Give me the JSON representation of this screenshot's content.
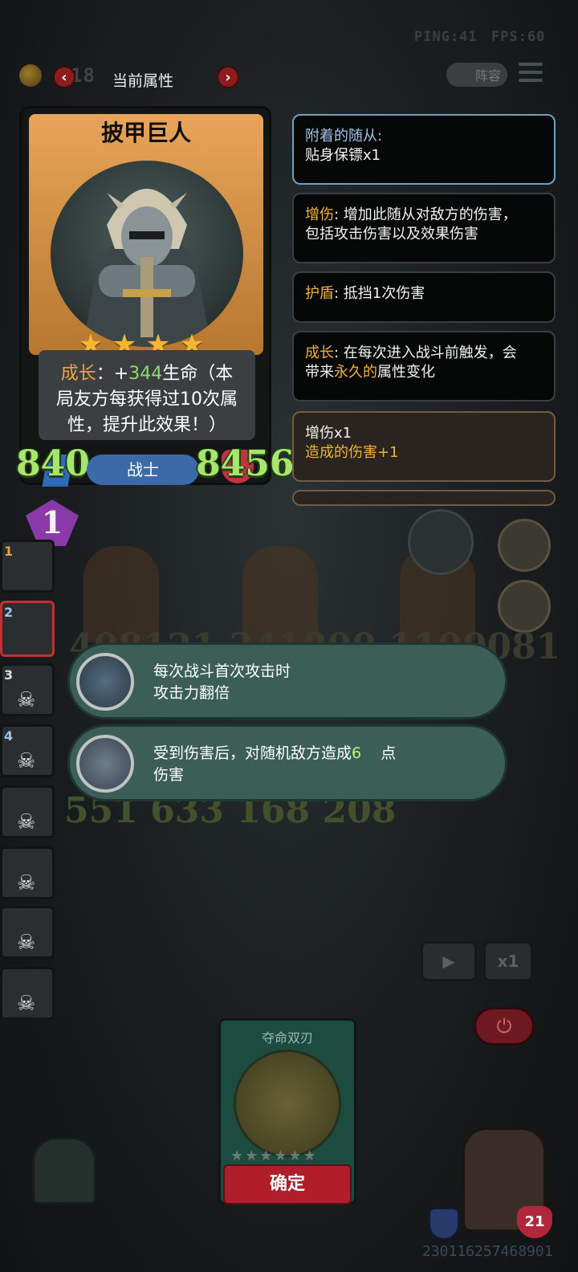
{
  "hud": {
    "ping": "PING:41",
    "fps": "FPS:60",
    "coin_value": "18",
    "panel_title": "当前属性",
    "lineup_label": "阵容"
  },
  "hero": {
    "name": "披甲巨人",
    "stars": 4,
    "desc_line1_label": "成长",
    "desc_line1_sep": "：+",
    "desc_line1_value": "344",
    "desc_line1_rest": "生命（本",
    "desc_line2": "局友方每获得过10次属",
    "desc_line3": "性，提升此效果！）",
    "attack": "840",
    "health": "8456",
    "class": "战士",
    "level_badge": "1"
  },
  "info": {
    "attached_title": "附着的随从:",
    "attached_value": "贴身保镖x1",
    "dmg_kw": "增伤",
    "dmg_line1": ": 增加此随从对敌方的伤害，",
    "dmg_line2": "包括攻击伤害以及效果伤害",
    "shield_kw": "护盾",
    "shield_text": ": 抵挡1次伤害",
    "grow_kw": "成长",
    "grow_line1": ": 在每次进入战斗前触发，会",
    "grow_line2_a": "带来",
    "grow_line2_kw": "永久的",
    "grow_line2_b": "属性变化",
    "buff_title": "增伤x1",
    "buff_line": "造成的伤害+1"
  },
  "sidebar": {
    "slots": [
      "1",
      "2",
      "3",
      "4"
    ]
  },
  "boons": {
    "first_line1": "每次战斗首次攻击时",
    "first_line2": "攻击力翻倍",
    "second_line1_a": "受到伤害后，对随机敌方造成",
    "second_line1_num": "6",
    "second_line1_b": "点",
    "second_line2": "伤害"
  },
  "background_nums": {
    "row1": "408121 341800 1100081",
    "row2": "551 633 168 208"
  },
  "loot": {
    "name": "夺命双刃",
    "stars": 6,
    "confirm_label": "确定"
  },
  "speed": {
    "speed_label": "x1"
  },
  "footer": {
    "shield_count": "21",
    "build_id": "230116257468901"
  },
  "colors": {
    "keyword": "#f2b32e",
    "stat_green": "#a6e66d",
    "confirm_red": "#b21d2c",
    "boon_teal": "#3b5f56"
  }
}
